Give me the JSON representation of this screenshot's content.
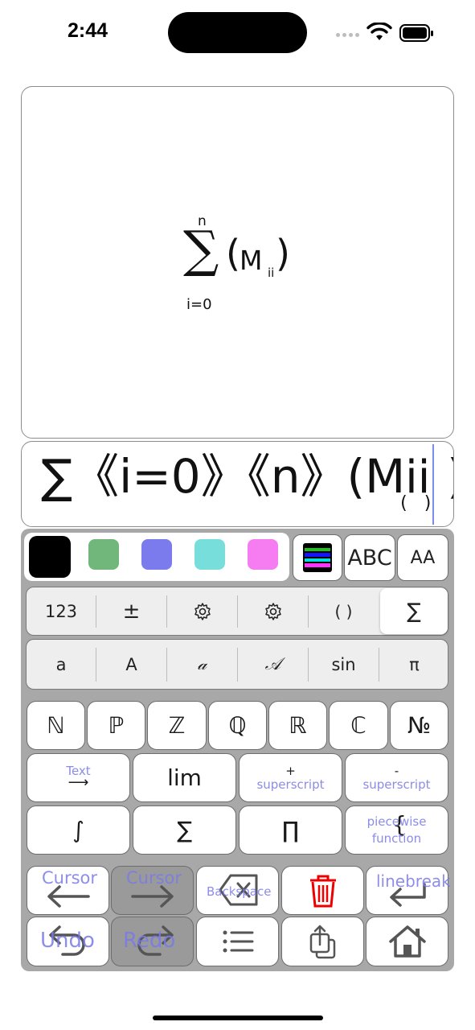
{
  "status_bar": {
    "time": "2:44"
  },
  "render": {
    "sum_symbol": "∑",
    "upper_limit": "n",
    "lower_limit": "i=0",
    "open_paren": "(",
    "body": "M",
    "subscript": "ii",
    "close_paren": ")"
  },
  "source": {
    "text_before": "∑《i=0》《n》(M",
    "sub_parens": "(   )",
    "text_sub": "ii",
    "text_after": ")"
  },
  "colors": {
    "swatches": [
      "#000000",
      "#71b77c",
      "#7b7bee",
      "#77dedb",
      "#f57cf1"
    ],
    "accent": "#7b8de8"
  },
  "keyboard": {
    "color_row": {
      "abc_label": "ABC",
      "case_label": "AA"
    },
    "category_tabs": [
      "123",
      "±",
      "⚙",
      "⚙",
      "( )",
      "∑"
    ],
    "style_tabs": [
      "a",
      "A",
      "𝒶",
      "𝒜",
      "sin",
      "π"
    ],
    "set_keys": [
      "ℕ",
      "ℙ",
      "ℤ",
      "ℚ",
      "ℝ",
      "ℂ",
      "№"
    ],
    "text_key": {
      "label": "Text",
      "arrow": "⟶"
    },
    "lim_key": "lim",
    "superscript_plus": {
      "sign": "+",
      "label": "superscript"
    },
    "superscript_minus": {
      "sign": "-",
      "label": "superscript"
    },
    "integral_key": "∫",
    "sum_key": "∑",
    "product_key": "∏",
    "piecewise_key": {
      "label_top": "piecewise",
      "label_bottom": "function",
      "brace": "{"
    },
    "cursor_left": {
      "label": "Cursor",
      "arrow": "⟵"
    },
    "cursor_right": {
      "label": "Cursor",
      "arrow": "⟶"
    },
    "backspace": {
      "label": "Backspace"
    },
    "linebreak": {
      "label": "linebreak"
    },
    "undo": {
      "label": "Undo"
    },
    "redo": {
      "label": "Redo"
    }
  }
}
